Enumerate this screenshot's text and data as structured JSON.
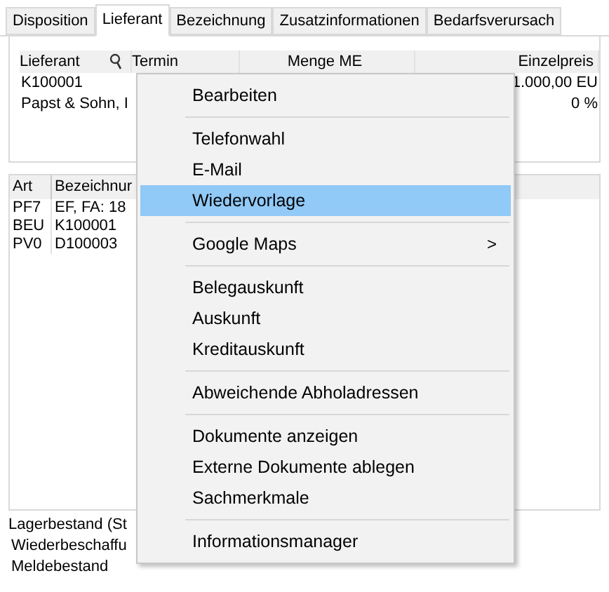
{
  "tabs": [
    {
      "label": "Disposition",
      "selected": false
    },
    {
      "label": "Lieferant",
      "selected": true
    },
    {
      "label": "Bezeichnung",
      "selected": false
    },
    {
      "label": "Zusatzinformationen",
      "selected": false
    },
    {
      "label": "Bedarfsverursach",
      "selected": false
    }
  ],
  "supplier_table": {
    "columns": [
      "Lieferant",
      "Termin",
      "Menge ME",
      "Einzelpreis"
    ],
    "rows": [
      {
        "lieferant": "K100001",
        "einzelpreis": "1.000,00 EU"
      },
      {
        "lieferant": "Papst & Sohn, I",
        "einzelpreis": "0 %"
      }
    ]
  },
  "document_table": {
    "columns": [
      "Art",
      "Bezeichnur"
    ],
    "rows": [
      [
        "PF7",
        "EF, FA: 18"
      ],
      [
        "BEU",
        "K100001"
      ],
      [
        "PV0",
        "D100003"
      ]
    ]
  },
  "stock_labels": [
    "Lagerbestand (St",
    "Wiederbeschaffu",
    "Meldebestand"
  ],
  "context_menu": [
    {
      "kind": "item",
      "label": "Bearbeiten",
      "selected": false
    },
    {
      "kind": "separator"
    },
    {
      "kind": "item",
      "label": "Telefonwahl",
      "selected": false
    },
    {
      "kind": "item",
      "label": "E-Mail",
      "selected": false
    },
    {
      "kind": "item",
      "label": "Wiedervorlage",
      "selected": true
    },
    {
      "kind": "separator"
    },
    {
      "kind": "submenu",
      "label": "Google Maps",
      "arrow": ">",
      "selected": false
    },
    {
      "kind": "separator"
    },
    {
      "kind": "item",
      "label": "Belegauskunft",
      "selected": false
    },
    {
      "kind": "item",
      "label": "Auskunft",
      "selected": false
    },
    {
      "kind": "item",
      "label": "Kreditauskunft",
      "selected": false
    },
    {
      "kind": "separator"
    },
    {
      "kind": "item",
      "label": "Abweichende Abholadressen",
      "selected": false
    },
    {
      "kind": "separator"
    },
    {
      "kind": "item",
      "label": "Dokumente anzeigen",
      "selected": false
    },
    {
      "kind": "item",
      "label": "Externe Dokumente ablegen",
      "selected": false
    },
    {
      "kind": "item",
      "label": "Sachmerkmale",
      "selected": false
    },
    {
      "kind": "separator"
    },
    {
      "kind": "item",
      "label": "Informationsmanager",
      "selected": false
    }
  ]
}
